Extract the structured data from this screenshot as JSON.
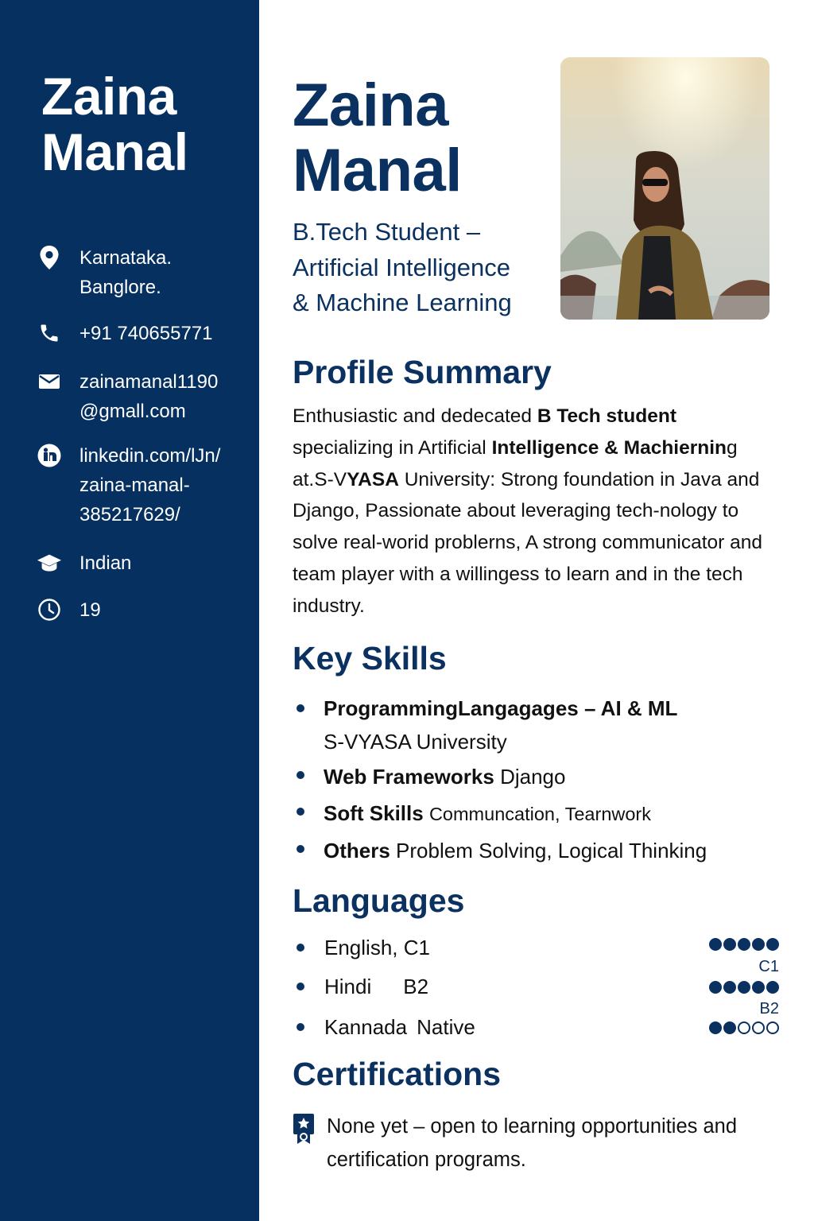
{
  "sidebar": {
    "name_line1": "Zaina",
    "name_line2": "Manal",
    "contacts": [
      {
        "icon": "location-pin-icon",
        "text": "Karnataka.\nBanglore."
      },
      {
        "icon": "phone-icon",
        "text": "+91 740655771"
      },
      {
        "icon": "mail-icon",
        "text": "zainamanal1190\n@gmall.com"
      },
      {
        "icon": "linkedin-icon",
        "text": "linkedin.com/lJn/\nzaina-manal-\n385217629/"
      },
      {
        "icon": "graduation-cap-icon",
        "text": "Indian"
      },
      {
        "icon": "clock-icon",
        "text": "19"
      }
    ],
    "colors": {
      "background": "#05305f",
      "text": "#ffffff"
    }
  },
  "header": {
    "name_line1": "Zaina",
    "name_line2": "Manal",
    "role": "B.Tech Student –\nArtificial Intelligence\n& Machine Learning",
    "photo": "profile-photo"
  },
  "summary": {
    "title": "Profile Summary",
    "p1": "Enthusiastic and dedecated ",
    "b1": "B  Tech student",
    "p2": " specializing in Artificial ",
    "b2": "Intelligence & Machiernin",
    "p3": "g at.S-V",
    "b3": "YASA",
    "p4": " University: Strong foundation in Java and Django, Passionate about leveraging tech-nology to solve real-worid problerns, A strong communicator and team player with a willingess to learn and in the tech industry."
  },
  "skills": {
    "title": "Key Skills",
    "items": [
      {
        "bold": "ProgrammingLangagages – AI & ML",
        "text": "S-VYASA University"
      },
      {
        "bold": "Web Frameworks",
        "text": "Django"
      },
      {
        "bold": "Soft Skills",
        "text": "Communcation, Tearnwork"
      },
      {
        "bold": "Others",
        "text": "Problem Solving, Logical Thinking"
      }
    ]
  },
  "languages": {
    "title": "Languages",
    "items": [
      {
        "name": "English, C1",
        "level": ""
      },
      {
        "name": "Hindi",
        "level": "B2"
      },
      {
        "name": "Kannada",
        "level": "Native"
      }
    ],
    "ratings": [
      {
        "filled": 5,
        "total": 5,
        "label": "C1"
      },
      {
        "filled": 5,
        "total": 5,
        "label": "B2"
      },
      {
        "filled": 2,
        "total": 5,
        "label": ""
      }
    ]
  },
  "certifications": {
    "title": "Certifications",
    "text": "None yet – open to learning opportunities and certification programs."
  },
  "colors": {
    "accent": "#0a3160"
  }
}
